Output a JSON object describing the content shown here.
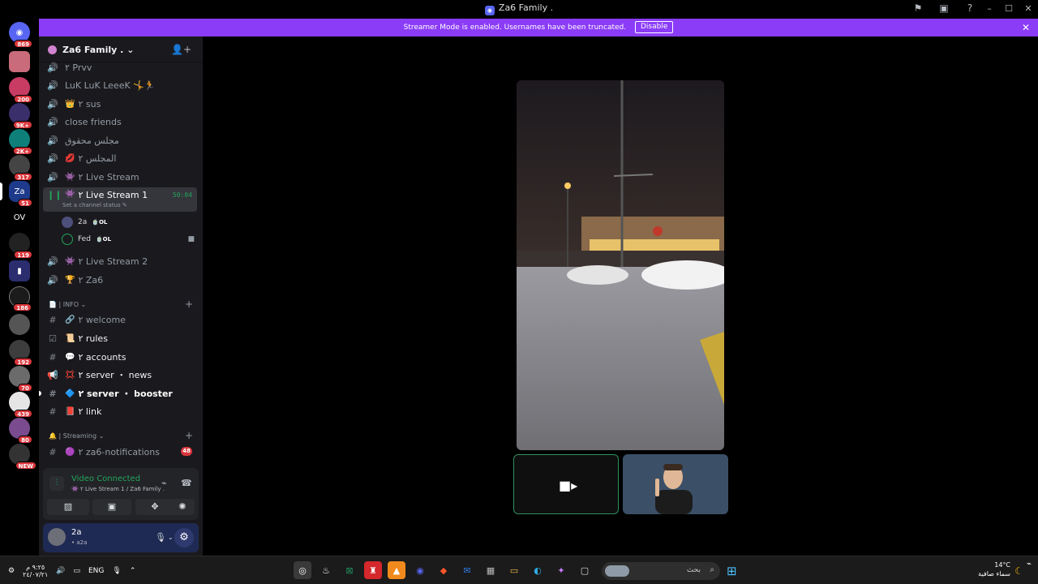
{
  "window": {
    "title": "Za6 Family .",
    "app_icon": "discord-icon"
  },
  "banner": {
    "text": "Streamer Mode is enabled. Usernames have been truncated.",
    "button": "Disable"
  },
  "guilds": [
    {
      "label": "",
      "badge": "869"
    },
    {
      "label": "",
      "badge": ""
    },
    {
      "label": "",
      "badge": "200"
    },
    {
      "label": "",
      "badge": "9K+"
    },
    {
      "label": "",
      "badge": "2K+"
    },
    {
      "label": "",
      "badge": "317"
    },
    {
      "label": "Za",
      "badge": "51"
    },
    {
      "label": "OV",
      "badge": ""
    },
    {
      "label": "",
      "badge": "119"
    },
    {
      "label": "",
      "badge": ""
    },
    {
      "label": "",
      "badge": "186"
    },
    {
      "label": "",
      "badge": ""
    },
    {
      "label": "",
      "badge": "192"
    },
    {
      "label": "",
      "badge": "70"
    },
    {
      "label": "",
      "badge": "439"
    },
    {
      "label": "",
      "badge": "80"
    },
    {
      "label": "",
      "badge": "NEW"
    }
  ],
  "server": {
    "name": "Za6 Family ."
  },
  "channels": [
    {
      "name": "٢ Prvv",
      "emoji": ""
    },
    {
      "name": "LuK LuK LeeeK 🤸🏃",
      "emoji": ""
    },
    {
      "name": "٢ sus",
      "emoji": "👑"
    },
    {
      "name": "close friends",
      "emoji": ""
    },
    {
      "name": "مجلس محقوق",
      "emoji": ""
    },
    {
      "name": "المجلس ٢",
      "emoji": "💋"
    },
    {
      "name": "٢ Live Stream",
      "emoji": "👾"
    }
  ],
  "active_channel": {
    "name": "٢ Live Stream 1",
    "emoji": "👾",
    "time": "50:04",
    "status": "Set a channel status ✎"
  },
  "voice_users": [
    {
      "name": "2a",
      "tag": "🍵OL"
    },
    {
      "name": "Fed",
      "tag": "🍵OL"
    }
  ],
  "channels_after": [
    {
      "name": "٢ Live Stream 2",
      "emoji": "👾"
    },
    {
      "name": "٢ Za6",
      "emoji": "🏆"
    }
  ],
  "category_info": "📄 | INFO ⌄",
  "info_channels": [
    {
      "name": "٢ welcome",
      "emoji": "🔗"
    },
    {
      "name": "٢ rules",
      "emoji": "📜"
    },
    {
      "name": "٢ accounts",
      "emoji": "💬"
    },
    {
      "name": "٢ server ・ news",
      "emoji": "💢"
    },
    {
      "name": "٢ server ・ booster",
      "emoji": "🔷"
    },
    {
      "name": "٢ link",
      "emoji": "📕"
    }
  ],
  "category_streaming": "🔔 | Streaming ⌄",
  "streaming_channels": [
    {
      "name": "٢ za6-notifications",
      "emoji": "🟣",
      "badge": "48"
    }
  ],
  "voice_panel": {
    "title": "Video Connected",
    "subtitle": "👾 ٢ Live Stream 1 / Za6 Family ."
  },
  "user": {
    "name": "2a",
    "status": "• a2a"
  },
  "taskbar": {
    "time": "٩:٢٥ م",
    "date": "٢٤/٠٧/٢١",
    "lang": "ENG",
    "search_placeholder": "بحث",
    "temp": "14°C",
    "weather": "سماء صافية"
  }
}
